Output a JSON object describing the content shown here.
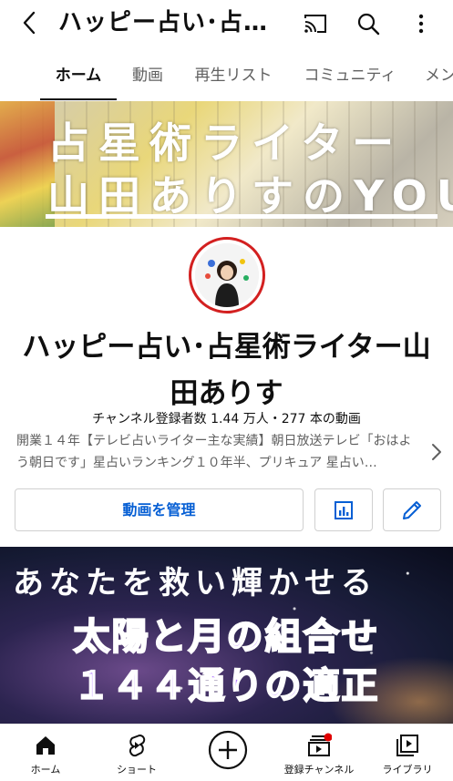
{
  "appbar": {
    "title": "ハッピー占い･占星術ライター山田ありす",
    "icons": [
      "back-icon",
      "cast-icon",
      "search-icon",
      "more-vert-icon"
    ]
  },
  "tabs": [
    {
      "label": "ホーム",
      "active": true
    },
    {
      "label": "動画",
      "active": false
    },
    {
      "label": "再生リスト",
      "active": false
    },
    {
      "label": "コミュニティ",
      "active": false
    },
    {
      "label": "メンバーシップ",
      "active": false
    }
  ],
  "banner": {
    "line1": "占星術ライター",
    "line2": "山田ありすのYOUTUBE"
  },
  "channel": {
    "name_line1": "ハッピー占い･占星術ライター山",
    "name_line2": "田ありす",
    "subscribers": "チャンネル登録者数 1.44 万人",
    "separator": "・",
    "videos": "277 本の動画",
    "description": "開業１４年【テレビ占いライター主な実績】朝日放送テレビ「おはよう朝日です」星占いランキング１０年半、プリキュア 星占い…"
  },
  "actions": {
    "manage_label": "動画を管理",
    "analytics_icon": "analytics-icon",
    "edit_icon": "edit-pencil-icon"
  },
  "featured": {
    "line1": "あなたを救い輝かせる",
    "line2": "太陽と月の組合せ",
    "line3": "１４４通りの適正"
  },
  "bottom_nav": [
    {
      "label": "ホーム",
      "icon": "home-icon"
    },
    {
      "label": "ショート",
      "icon": "shorts-icon"
    },
    {
      "label": "",
      "icon": "create-plus-icon"
    },
    {
      "label": "登録チャンネル",
      "icon": "subscriptions-icon"
    },
    {
      "label": "ライブラリ",
      "icon": "library-icon"
    }
  ],
  "colors": {
    "accent_blue": "#065fd4",
    "avatar_ring": "#d32020",
    "notification_dot": "#e00000",
    "featured_text": "#b47cff"
  }
}
